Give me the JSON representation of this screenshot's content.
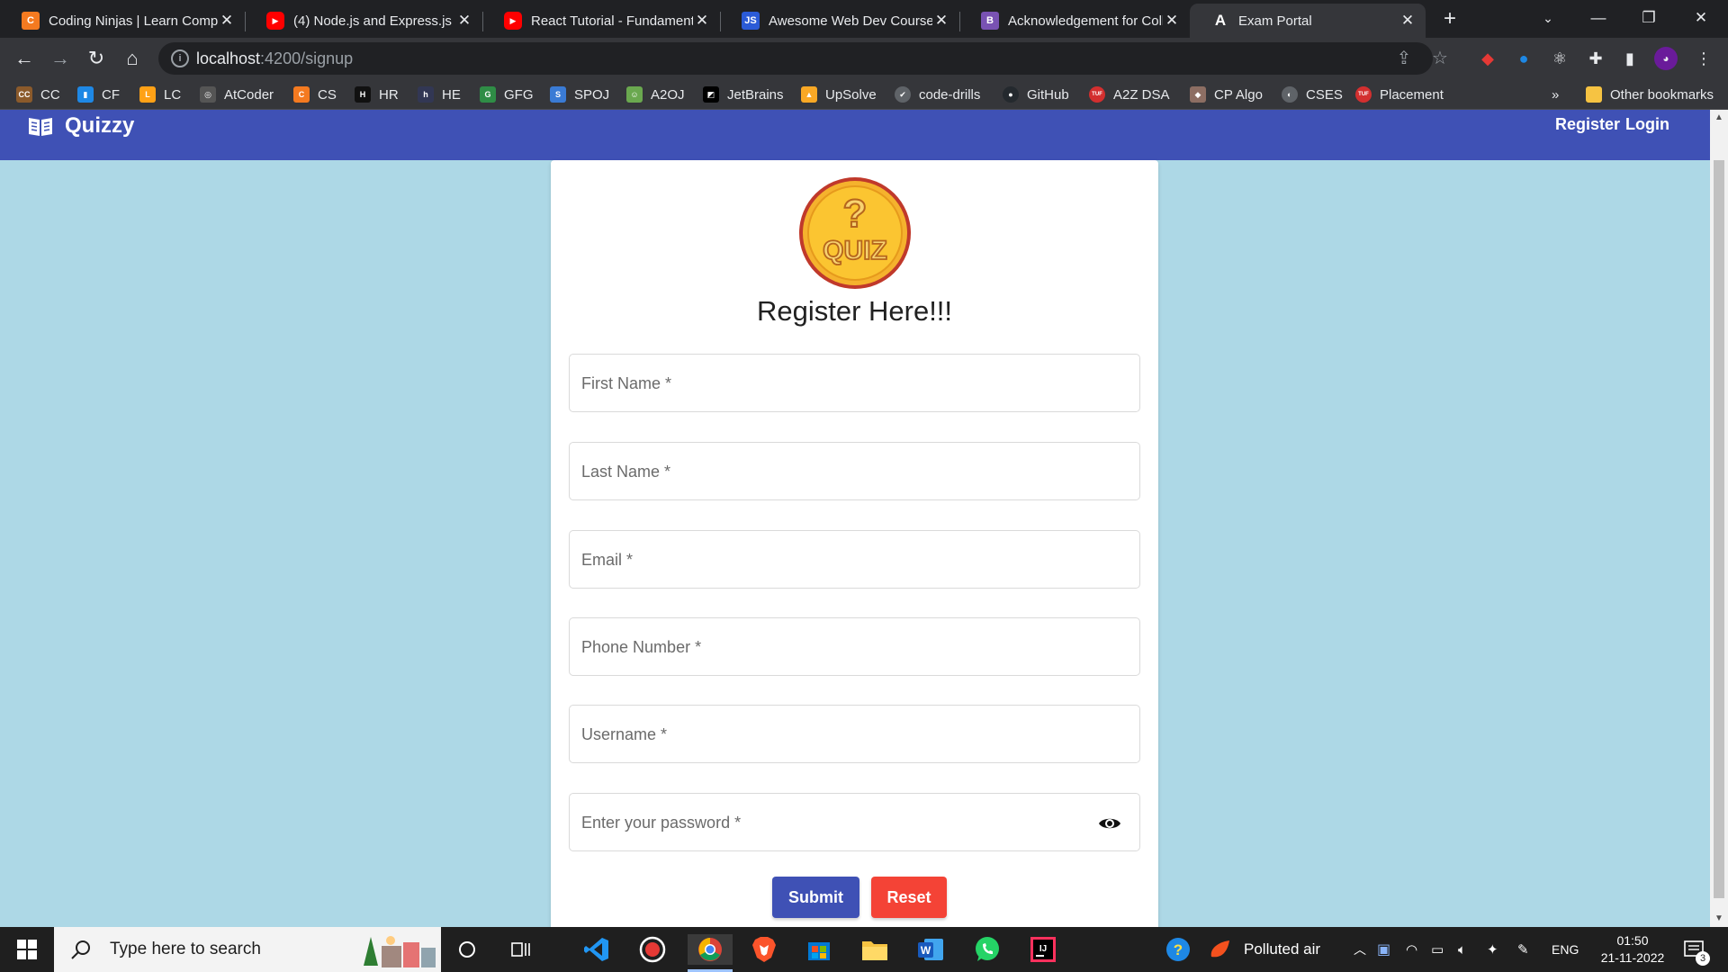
{
  "browser": {
    "tabs": [
      {
        "title": "Coding Ninjas | Learn Comp",
        "favicon": "coding-ninjas-icon",
        "color": "#f47a20",
        "glyph": "C"
      },
      {
        "title": "(4) Node.js and Express.js -",
        "favicon": "youtube-icon",
        "color": "#ff0000",
        "glyph": "▶"
      },
      {
        "title": "React Tutorial - Fundament",
        "favicon": "youtube-icon",
        "color": "#ff0000",
        "glyph": "▶"
      },
      {
        "title": "Awesome Web Dev Courses",
        "favicon": "js-icon",
        "color": "#2b5bd7",
        "glyph": "JS"
      },
      {
        "title": "Acknowledgement for Colle",
        "favicon": "bootstrap-icon",
        "color": "#7952b3",
        "glyph": "B"
      },
      {
        "title": "Exam Portal",
        "favicon": "angular-icon",
        "color": "#202124",
        "glyph": "A"
      }
    ],
    "url_host": "localhost",
    "url_path": ":4200/signup",
    "bookmarks": [
      {
        "label": "CC",
        "icon": "codechef-icon",
        "color": "#8b5a2b",
        "glyph": "CC"
      },
      {
        "label": "CF",
        "icon": "codeforces-icon",
        "color": "#1e88e5",
        "glyph": "▮"
      },
      {
        "label": "LC",
        "icon": "leetcode-icon",
        "color": "#ffa116",
        "glyph": "L"
      },
      {
        "label": "AtCoder",
        "icon": "atcoder-icon",
        "color": "#555555",
        "glyph": "◎"
      },
      {
        "label": "CS",
        "icon": "coding-ninjas-icon",
        "color": "#f47a20",
        "glyph": "C"
      },
      {
        "label": "HR",
        "icon": "hackerrank-icon",
        "color": "#111111",
        "glyph": "H"
      },
      {
        "label": "HE",
        "icon": "hackerearth-icon",
        "color": "#323754",
        "glyph": "h"
      },
      {
        "label": "GFG",
        "icon": "geeksforgeeks-icon",
        "color": "#2f8d46",
        "glyph": "G"
      },
      {
        "label": "SPOJ",
        "icon": "spoj-icon",
        "color": "#3a7bd5",
        "glyph": "S"
      },
      {
        "label": "A2OJ",
        "icon": "a2oj-icon",
        "color": "#6aa84f",
        "glyph": "☺"
      },
      {
        "label": "JetBrains",
        "icon": "jetbrains-icon",
        "color": "#000000",
        "glyph": "◩"
      },
      {
        "label": "UpSolve",
        "icon": "upsolve-icon",
        "color": "#f9a825",
        "glyph": "▲"
      },
      {
        "label": "code-drills",
        "icon": "check-circle-icon",
        "color": "#5f6368",
        "glyph": "✔"
      },
      {
        "label": "GitHub",
        "icon": "github-icon",
        "color": "#24292e",
        "glyph": "●"
      },
      {
        "label": "A2Z DSA",
        "icon": "tuf-icon",
        "color": "#d32f2f",
        "glyph": "TUF"
      },
      {
        "label": "CP Algo",
        "icon": "cp-algo-icon",
        "color": "#8d6e63",
        "glyph": "◆"
      },
      {
        "label": "CSES",
        "icon": "globe-icon",
        "color": "#5f6368",
        "glyph": "◐"
      },
      {
        "label": "Placement",
        "icon": "tuf-icon",
        "color": "#d32f2f",
        "glyph": "TUF"
      }
    ],
    "more_bookmarks": "»",
    "other_bookmarks": "Other bookmarks"
  },
  "app": {
    "brand": "Quizzy",
    "nav": {
      "register": "Register",
      "login": "Login"
    },
    "logo_text": "QUIZ",
    "logo_mark": "?",
    "form": {
      "title": "Register Here!!!",
      "fields": [
        {
          "label": "First Name *"
        },
        {
          "label": "Last Name *"
        },
        {
          "label": "Email *"
        },
        {
          "label": "Phone Number *"
        },
        {
          "label": "Username *"
        },
        {
          "label": "Enter your password *"
        }
      ],
      "submit": "Submit",
      "reset": "Reset"
    },
    "colors": {
      "primary": "#3f51b5",
      "warn": "#f44336",
      "background": "#add8e6"
    }
  },
  "taskbar": {
    "search_placeholder": "Type here to search",
    "weather": "Polluted air",
    "language": "ENG",
    "time": "01:50",
    "date": "21-11-2022",
    "notification_count": "3"
  }
}
